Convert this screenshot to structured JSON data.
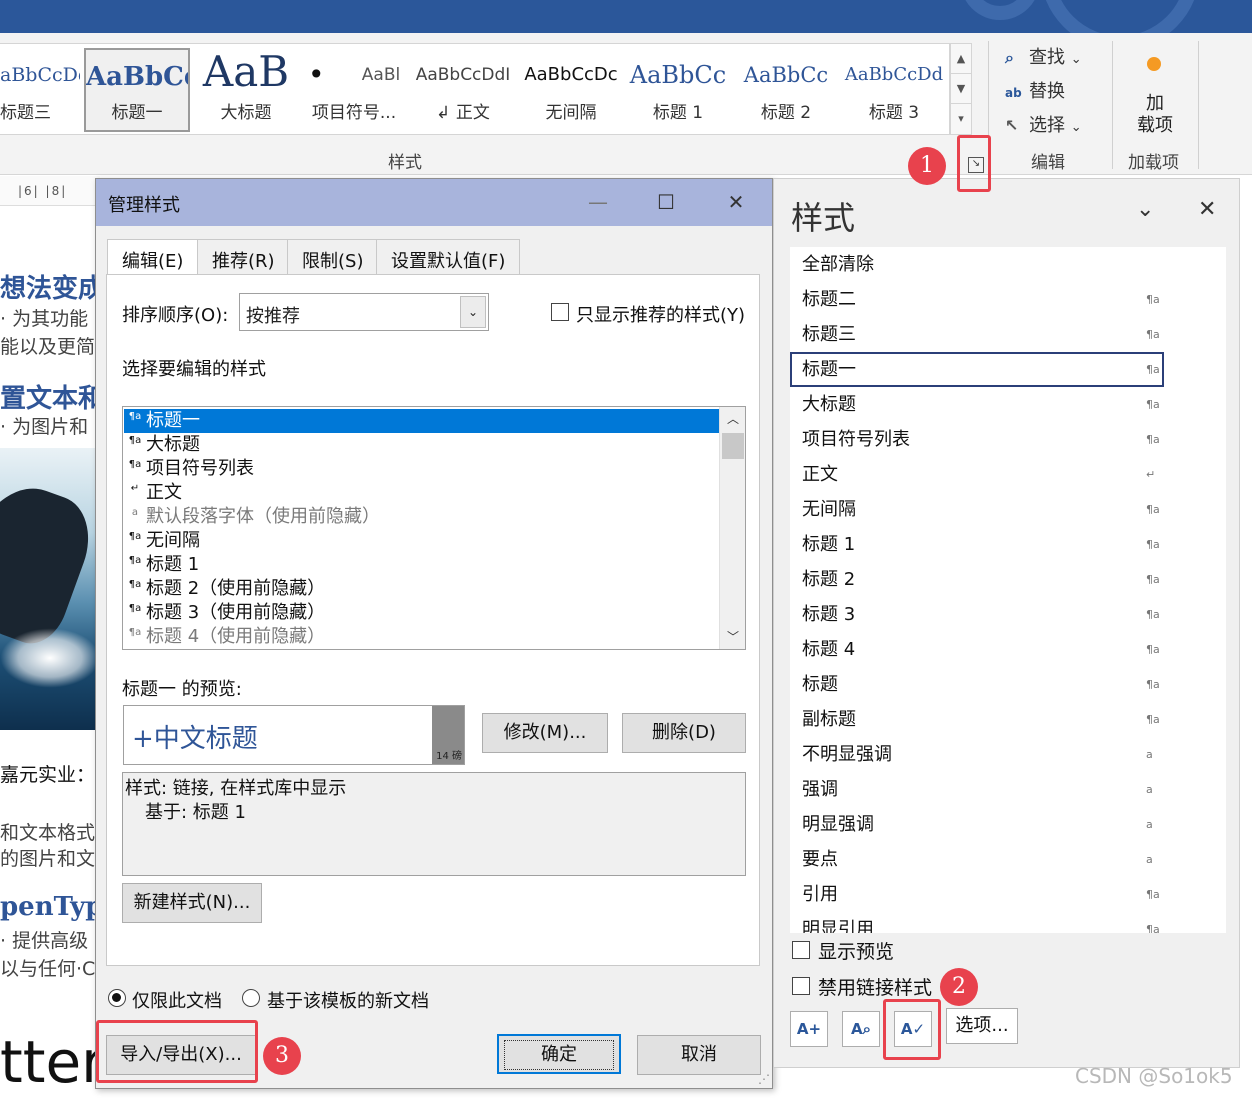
{
  "ribbon": {
    "styles_gallery": [
      {
        "sample": "aBbCcDd",
        "name": "标题三"
      },
      {
        "sample": "AaBbCc",
        "name": "标题一"
      },
      {
        "sample": "AaB",
        "name": "大标题"
      },
      {
        "sample": "•",
        "name": "项目符号..."
      },
      {
        "sample": "AaBl",
        "name": ""
      },
      {
        "sample": "AaBbCcDdI",
        "name": "↲ 正文"
      },
      {
        "sample": "AaBbCcDc",
        "name": "无间隔"
      },
      {
        "sample": "AaBbCc",
        "name": "标题 1"
      },
      {
        "sample": "AaBbCc",
        "name": "标题 2"
      },
      {
        "sample": "AaBbCcDd",
        "name": "标题 3"
      }
    ],
    "styles_group_label": "样式",
    "editing": {
      "find": "查找",
      "replace": "替换",
      "select": "选择",
      "group_label": "编辑"
    },
    "addins": {
      "button": "加载项",
      "button_line1": "加",
      "button_line2": "载项",
      "group_label": "加载项"
    }
  },
  "document": {
    "ruler": "|6| |8|",
    "lines": [
      "想法变成",
      "· 为其功能",
      "能以及更简",
      "置文本和图",
      "· 为图片和",
      "嘉元实业：",
      "和文本格式",
      "的图片和文",
      "penType",
      "· 提供高级",
      "以与任何·C"
    ],
    "big_text": "tter"
  },
  "dialog": {
    "title": "管理样式",
    "tabs": [
      "编辑(E)",
      "推荐(R)",
      "限制(S)",
      "设置默认值(F)"
    ],
    "sort_label": "排序顺序(O):",
    "sort_value": "按推荐",
    "only_recommended": "只显示推荐的样式(Y)",
    "select_label": "选择要编辑的样式",
    "styles": [
      {
        "glyph": "¶a",
        "name": "标题一",
        "selected": true
      },
      {
        "glyph": "¶a",
        "name": "大标题"
      },
      {
        "glyph": "¶a",
        "name": "项目符号列表"
      },
      {
        "glyph": "↵",
        "name": "正文"
      },
      {
        "glyph": "a",
        "name": "默认段落字体（使用前隐藏）",
        "dim": true
      },
      {
        "glyph": "¶a",
        "name": "无间隔"
      },
      {
        "glyph": "¶a",
        "name": "标题 1"
      },
      {
        "glyph": "¶a",
        "name": "标题 2（使用前隐藏）"
      },
      {
        "glyph": "¶a",
        "name": "标题 3（使用前隐藏）"
      },
      {
        "glyph": "¶a",
        "name": "标题 4（使用前隐藏）",
        "dim": true
      }
    ],
    "preview_label": "标题一 的预览:",
    "preview_text": "+中文标题",
    "preview_size": "14 磅",
    "modify_button": "修改(M)...",
    "delete_button": "删除(D)",
    "description_line1": "样式: 链接, 在样式库中显示",
    "description_line2": "基于: 标题 1",
    "new_style_button": "新建样式(N)...",
    "scope_document": "仅限此文档",
    "scope_template": "基于该模板的新文档",
    "import_export_button": "导入/导出(X)...",
    "ok_button": "确定",
    "cancel_button": "取消"
  },
  "styles_pane": {
    "title": "样式",
    "items": [
      {
        "name": "全部清除",
        "mark": ""
      },
      {
        "name": "标题二",
        "mark": "¶a"
      },
      {
        "name": "标题三",
        "mark": "¶a"
      },
      {
        "name": "标题一",
        "mark": "¶a",
        "selected": true
      },
      {
        "name": "大标题",
        "mark": "¶a"
      },
      {
        "name": "项目符号列表",
        "mark": "¶a"
      },
      {
        "name": "正文",
        "mark": "↵"
      },
      {
        "name": "无间隔",
        "mark": "¶a"
      },
      {
        "name": "标题 1",
        "mark": "¶a"
      },
      {
        "name": "标题 2",
        "mark": "¶a"
      },
      {
        "name": "标题 3",
        "mark": "¶a"
      },
      {
        "name": "标题 4",
        "mark": "¶a"
      },
      {
        "name": "标题",
        "mark": "¶a"
      },
      {
        "name": "副标题",
        "mark": "¶a"
      },
      {
        "name": "不明显强调",
        "mark": "a"
      },
      {
        "name": "强调",
        "mark": "a"
      },
      {
        "name": "明显强调",
        "mark": "a"
      },
      {
        "name": "要点",
        "mark": "a"
      },
      {
        "name": "引用",
        "mark": "¶a"
      },
      {
        "name": "明显引用",
        "mark": "¶a"
      }
    ],
    "show_preview": "显示预览",
    "disable_linked": "禁用链接样式",
    "options_button": "选项..."
  },
  "annotations": {
    "badge1": "1",
    "badge2": "2",
    "badge3": "3",
    "accent_color": "#e8424d"
  },
  "watermark": "CSDN @So1ok5"
}
